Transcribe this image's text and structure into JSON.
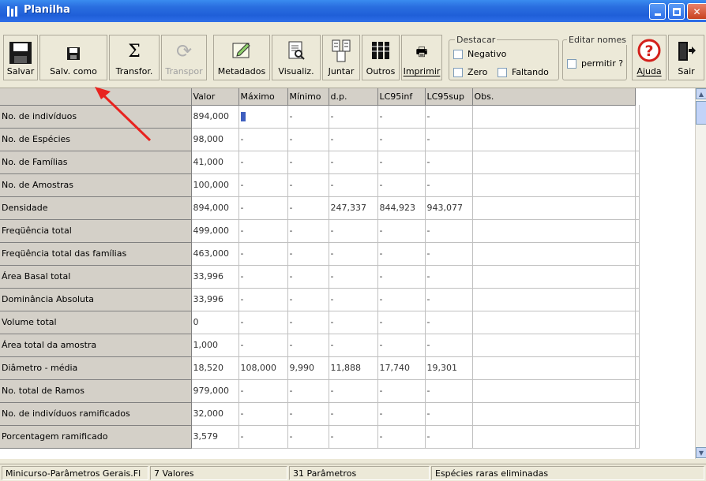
{
  "window": {
    "title": "Planilha"
  },
  "toolbar": {
    "buttons": [
      {
        "label": "Salvar",
        "icon": "floppy-large-icon"
      },
      {
        "label": "Salv. como",
        "icon": "floppy-small-icon"
      },
      {
        "label": "Transfor.",
        "icon": "sigma-icon"
      },
      {
        "label": "Transpor",
        "icon": "refresh-icon"
      },
      {
        "label": "Metadados",
        "icon": "edit-pencil-icon"
      },
      {
        "label": "Visualiz.",
        "icon": "preview-icon"
      },
      {
        "label": "Juntar",
        "icon": "merge-icon"
      },
      {
        "label": "Outros",
        "icon": "columns-icon"
      },
      {
        "label": "Imprimir",
        "icon": "printer-icon"
      },
      {
        "label": "Ajuda",
        "icon": "help-icon"
      },
      {
        "label": "Sair",
        "icon": "exit-door-icon"
      }
    ],
    "destacar": {
      "title": "Destacar",
      "negativo": "Negativo",
      "zero": "Zero",
      "faltando": "Faltando"
    },
    "editar_nomes": {
      "title": "Editar nomes",
      "permitir": "permitir ?"
    }
  },
  "grid": {
    "columns": [
      "Valor",
      "Máximo",
      "Mínimo",
      "d.p.",
      "LC95inf",
      "LC95sup",
      "Obs."
    ],
    "rows": [
      {
        "name": "No. de indivíduos",
        "cells": [
          "894,000",
          "",
          "-",
          "-",
          "-",
          "-",
          ""
        ]
      },
      {
        "name": "No. de Espécies",
        "cells": [
          "98,000",
          "-",
          "-",
          "-",
          "-",
          "-",
          ""
        ]
      },
      {
        "name": "No. de Famílias",
        "cells": [
          "41,000",
          "-",
          "-",
          "-",
          "-",
          "-",
          ""
        ]
      },
      {
        "name": "No. de Amostras",
        "cells": [
          "100,000",
          "-",
          "-",
          "-",
          "-",
          "-",
          ""
        ]
      },
      {
        "name": "Densidade",
        "cells": [
          "894,000",
          "-",
          "-",
          "247,337",
          "844,923",
          "943,077",
          ""
        ]
      },
      {
        "name": "Freqüência total",
        "cells": [
          "499,000",
          "-",
          "-",
          "-",
          "-",
          "-",
          ""
        ]
      },
      {
        "name": "Freqüência total das famílias",
        "cells": [
          "463,000",
          "-",
          "-",
          "-",
          "-",
          "-",
          ""
        ]
      },
      {
        "name": "Área Basal total",
        "cells": [
          "33,996",
          "-",
          "-",
          "-",
          "-",
          "-",
          ""
        ]
      },
      {
        "name": "Dominância Absoluta",
        "cells": [
          "33,996",
          "-",
          "-",
          "-",
          "-",
          "-",
          ""
        ]
      },
      {
        "name": "Volume total",
        "cells": [
          "0",
          "-",
          "-",
          "-",
          "-",
          "-",
          ""
        ]
      },
      {
        "name": "Área total da amostra",
        "cells": [
          "1,000",
          "-",
          "-",
          "-",
          "-",
          "-",
          ""
        ]
      },
      {
        "name": "Diâmetro - média",
        "cells": [
          "18,520",
          "108,000",
          "9,990",
          "11,888",
          "17,740",
          "19,301",
          ""
        ]
      },
      {
        "name": "No. total de Ramos",
        "cells": [
          "979,000",
          "-",
          "-",
          "-",
          "-",
          "-",
          ""
        ]
      },
      {
        "name": "No. de indivíduos ramificados",
        "cells": [
          "32,000",
          "-",
          "-",
          "-",
          "-",
          "-",
          ""
        ]
      },
      {
        "name": "Porcentagem ramificado",
        "cells": [
          "3,579",
          "-",
          "-",
          "-",
          "-",
          "-",
          ""
        ]
      }
    ]
  },
  "statusbar": {
    "file": "Minicurso-Parâmetros Gerais.Fl",
    "values": "7 Valores",
    "params": "31 Parâmetros",
    "note": "Espécies raras eliminadas"
  },
  "colors": {
    "titlebar": "#2a6fe0",
    "annotation_arrow": "#e8231f"
  }
}
